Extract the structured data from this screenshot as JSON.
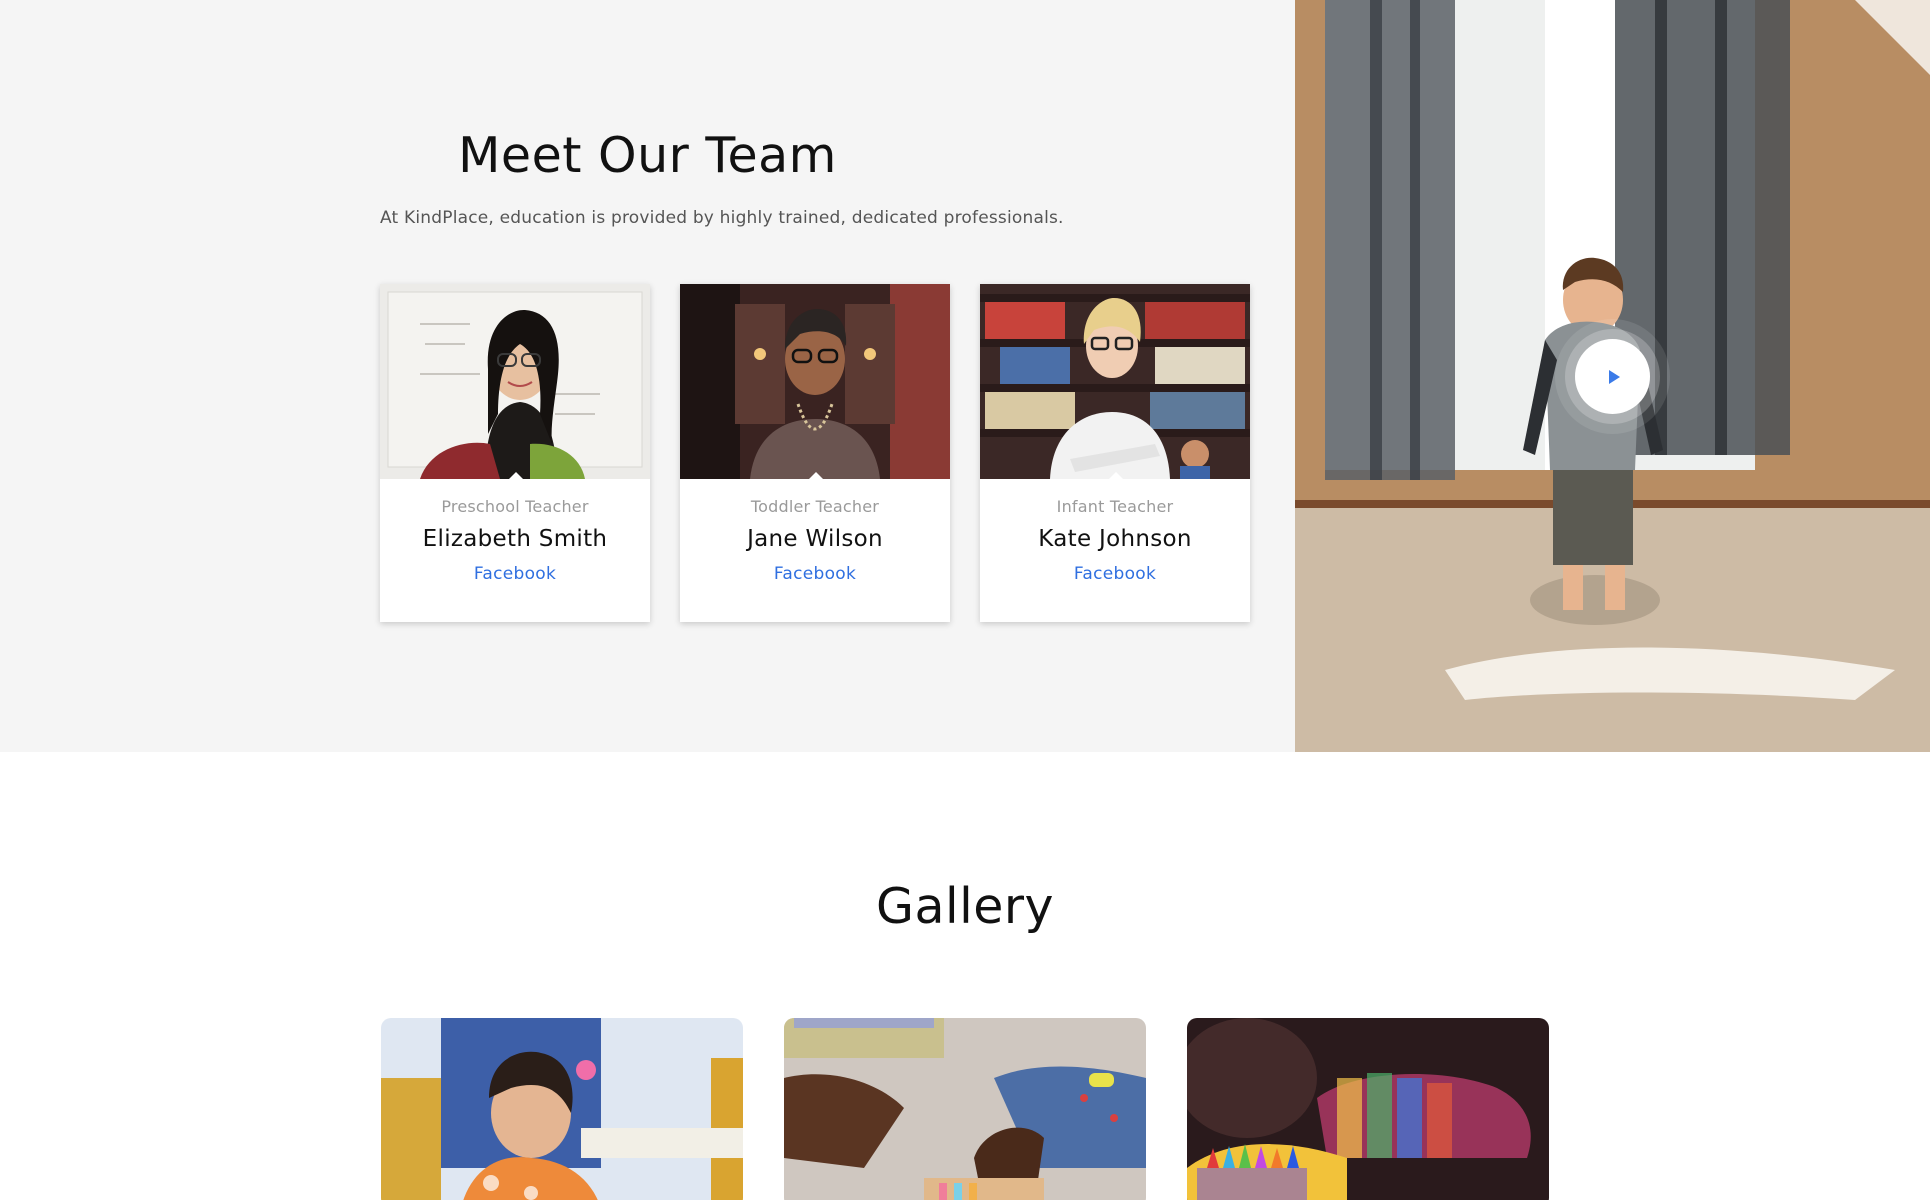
{
  "team": {
    "title": "Meet Our Team",
    "subtitle": "At KindPlace, education is provided by highly trained, dedicated professionals.",
    "members": [
      {
        "role": "Preschool Teacher",
        "name": "Elizabeth Smith",
        "link": "Facebook"
      },
      {
        "role": "Toddler Teacher",
        "name": "Jane Wilson",
        "link": "Facebook"
      },
      {
        "role": "Infant Teacher",
        "name": "Kate Johnson",
        "link": "Facebook"
      }
    ]
  },
  "video": {
    "play_icon": "play-icon"
  },
  "gallery": {
    "title": "Gallery"
  },
  "colors": {
    "accent": "#2f6fe0",
    "title_highlight": "#e4ecfa",
    "section_bg": "#f5f5f5"
  }
}
